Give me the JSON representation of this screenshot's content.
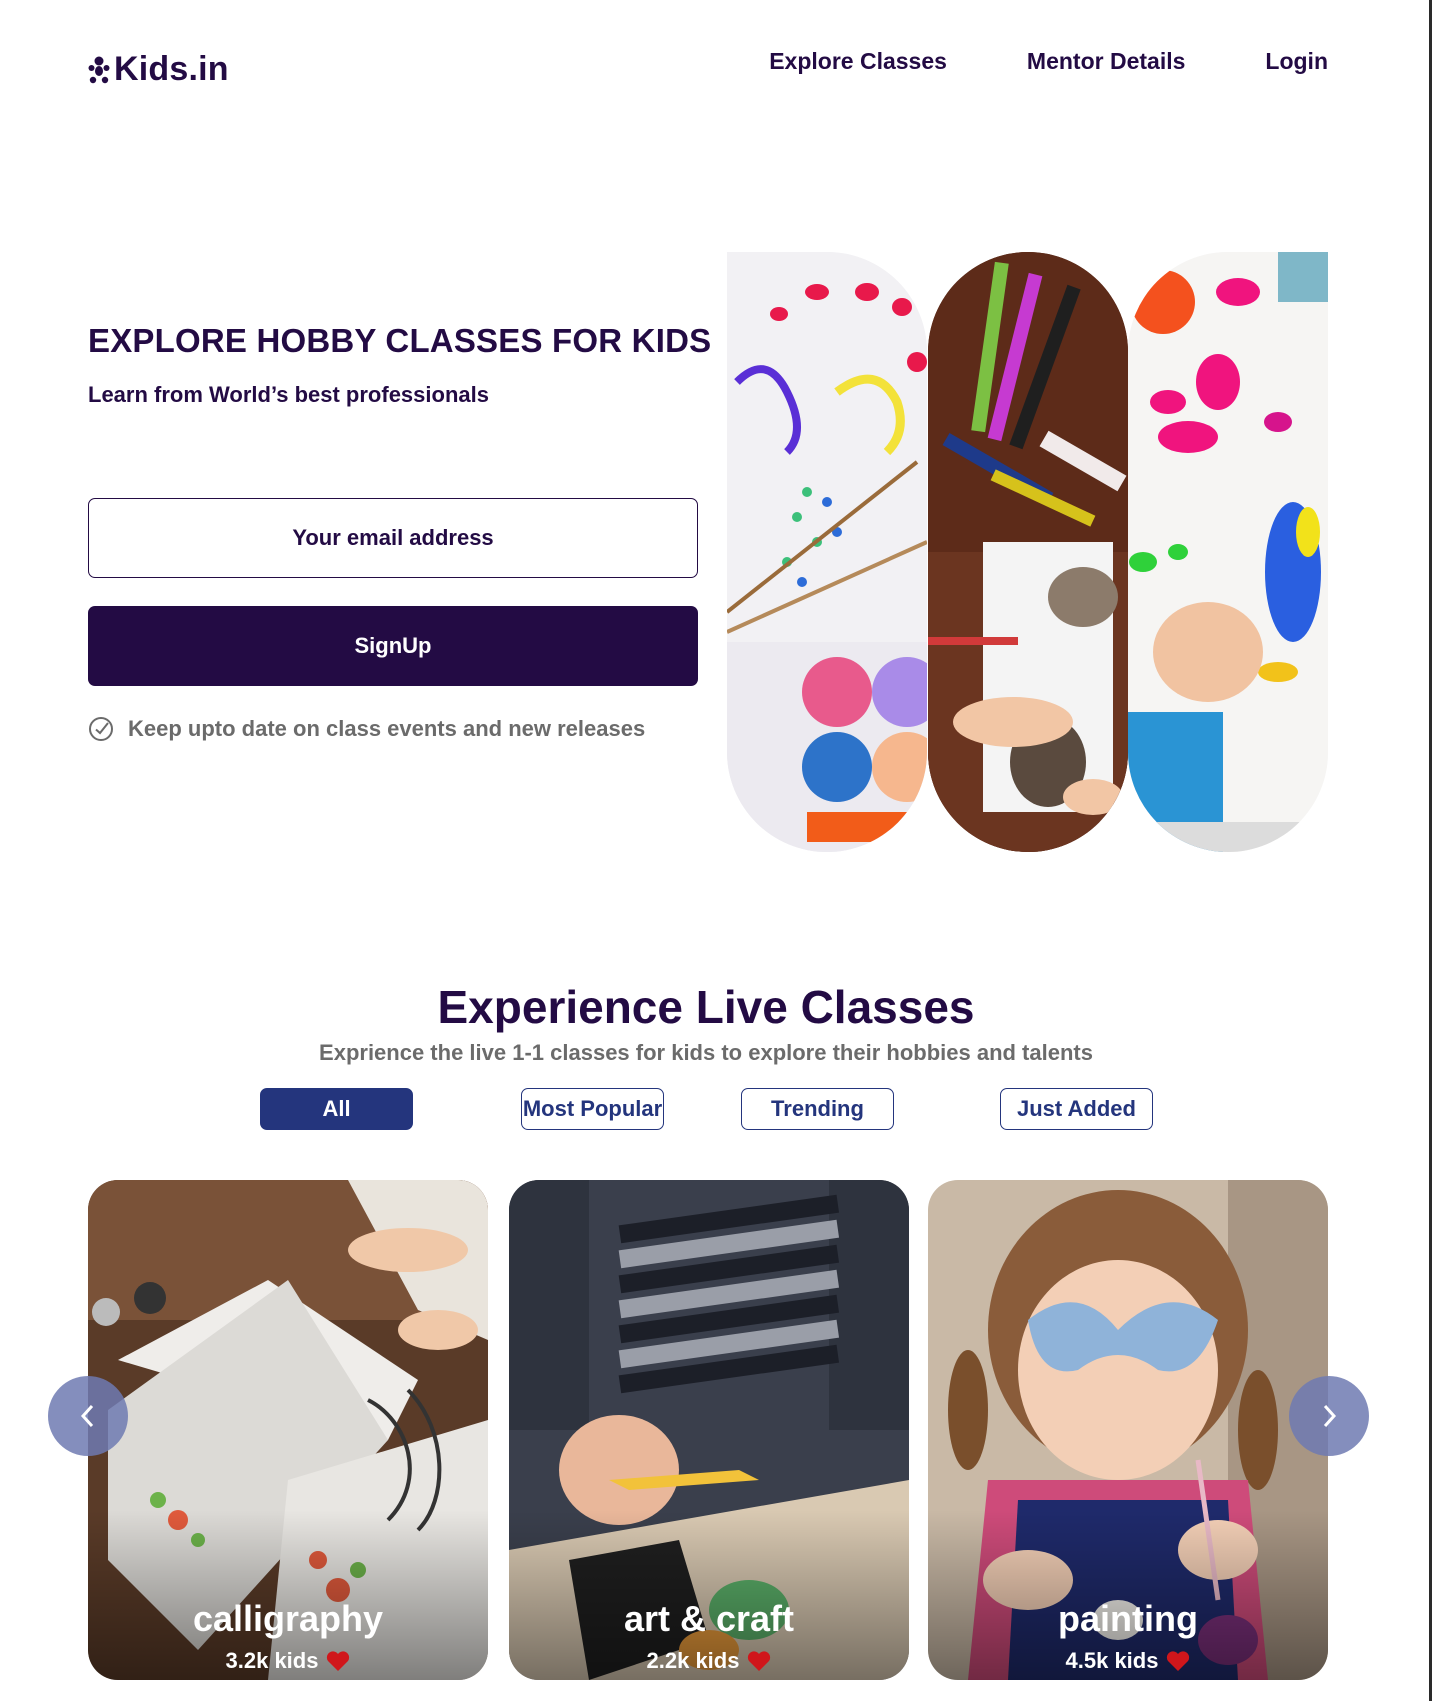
{
  "header": {
    "logo_text": "Kids.in",
    "nav": [
      "Explore Classes",
      "Mentor Details",
      "Login"
    ]
  },
  "hero": {
    "title": "EXPLORE HOBBY CLASSES FOR KIDS",
    "subtitle": "Learn from World’s best professionals",
    "email_placeholder": "Your email address",
    "signup_label": "SignUp",
    "keep_text": "Keep upto date on class events and new releases"
  },
  "classes": {
    "title": "Experience Live Classes",
    "subtitle": "Exprience the live 1-1 classes for kids to explore their hobbies and talents",
    "filters": [
      "All",
      "Most Popular",
      "Trending",
      "Just Added"
    ],
    "active_filter": "All",
    "cards": [
      {
        "name": "calligraphy",
        "count": "3.2k kids"
      },
      {
        "name": "art & craft",
        "count": "2.2k kids"
      },
      {
        "name": "painting",
        "count": "4.5k kids"
      }
    ]
  },
  "colors": {
    "primary": "#230b44",
    "accent": "#24357d",
    "muted": "#6b6b6b",
    "heart": "#d0161b"
  }
}
